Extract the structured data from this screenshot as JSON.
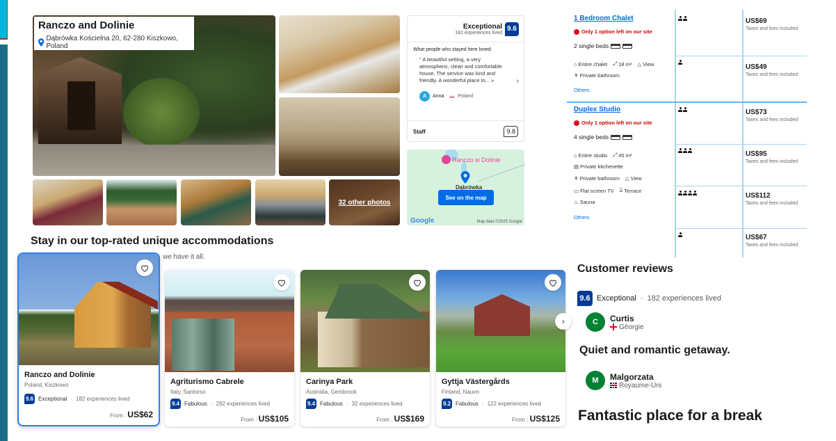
{
  "property": {
    "name": "Ranczo and Dolinie",
    "address": "Dąbrówka Kościelna 20, 62-280 Kiszkowo, Poland",
    "more_photos_label": "32 other photos"
  },
  "review_summary": {
    "rating_word": "Exceptional",
    "experiences": "182 experiences lived",
    "score": "9.6",
    "loved_heading": "What people who stayed here loved:",
    "quote": "\" A beautiful setting, a very atmospheric, clean and comfortable house. The service was kind and friendly. A wonderful place to... »",
    "reviewer_initial": "A",
    "reviewer_name": "Anna",
    "reviewer_country": "Poland",
    "category_label": "Staff",
    "category_score": "9.8"
  },
  "map": {
    "hotel_label": "Ranczo w Dolinie",
    "town_label": "Dąbrówka",
    "button_label": "See on the map",
    "provider": "Google",
    "attribution": "Map data ©2025 Google"
  },
  "unique_section": {
    "title": "Stay in our top-rated unique accommodations",
    "subtitle": "we have it all.",
    "cards": [
      {
        "name": "Ranczo and Dolinie",
        "location": "Poland, Kiszkowo",
        "score": "9.6",
        "rating_word": "Exceptional",
        "experiences": "182 experiences lived",
        "price_prefix": "From :",
        "price": "US$62"
      },
      {
        "name": "Agriturismo Cabrele",
        "location": "Italy, Santorso",
        "score": "9.4",
        "rating_word": "Fabulous",
        "experiences": "292 experiences lived",
        "price_prefix": "From :",
        "price": "US$105"
      },
      {
        "name": "Carinya Park",
        "location": "Australia, Gembrook",
        "score": "9.4",
        "rating_word": "Fabulous",
        "experiences": "32 experiences lived",
        "price_prefix": "From :",
        "price": "US$169"
      },
      {
        "name": "Gyttja Västergårds",
        "location": "Finland, Nauvo",
        "score": "9.2",
        "rating_word": "Fabulous",
        "experiences": "122 experiences lived",
        "price_prefix": "From :",
        "price": "US$125"
      }
    ]
  },
  "rooms": [
    {
      "name": "1 Bedroom Chalet",
      "scarcity": "Only 1 option left on our site",
      "beds": "2 single beds",
      "facilities": [
        [
          "Entire chalet",
          "18 m²",
          "View"
        ],
        [
          "Private bathroom"
        ]
      ],
      "others_label": "Others",
      "options": [
        {
          "guests": 2,
          "price": "US$69",
          "tax_note": "Taxes and fees included"
        },
        {
          "guests": 1,
          "price": "US$49",
          "tax_note": "Taxes and fees included"
        }
      ]
    },
    {
      "name": "Duplex Studio",
      "scarcity": "Only 1 option left on our site",
      "beds": "4 single beds",
      "facilities": [
        [
          "Entire studio",
          "45 m²"
        ],
        [
          "Private kitchenette"
        ],
        [
          "Private bathroom",
          "View"
        ],
        [
          "Flat screen TV",
          "Terrace"
        ],
        [
          "Sauna"
        ]
      ],
      "others_label": "Others",
      "options": [
        {
          "guests": 2,
          "price": "US$73",
          "tax_note": "Taxes and fees included"
        },
        {
          "guests": 3,
          "price": "US$95",
          "tax_note": "Taxes and fees included"
        },
        {
          "guests": 4,
          "price": "US$112",
          "tax_note": "Taxes and fees included"
        },
        {
          "guests": 1,
          "price": "US$67",
          "tax_note": "Taxes and fees included"
        }
      ]
    }
  ],
  "customer_reviews": {
    "title": "Customer reviews",
    "score": "9.6",
    "rating_word": "Exceptional",
    "separator": "·",
    "experiences": "182 experiences lived",
    "reviews": [
      {
        "initial": "C",
        "name": "Curtis",
        "country": "Géorgie",
        "title": "Quiet and romantic getaway."
      },
      {
        "initial": "M",
        "name": "Malgorzata",
        "country": "Royaume-Uni",
        "title": "Fantastic place for a break"
      }
    ]
  },
  "colors": {
    "brand_blue": "#003b95",
    "link_blue": "#006ce4",
    "scarcity_red": "#c00000",
    "avatar_green": "#008234",
    "table_border": "#a8d4f5"
  }
}
